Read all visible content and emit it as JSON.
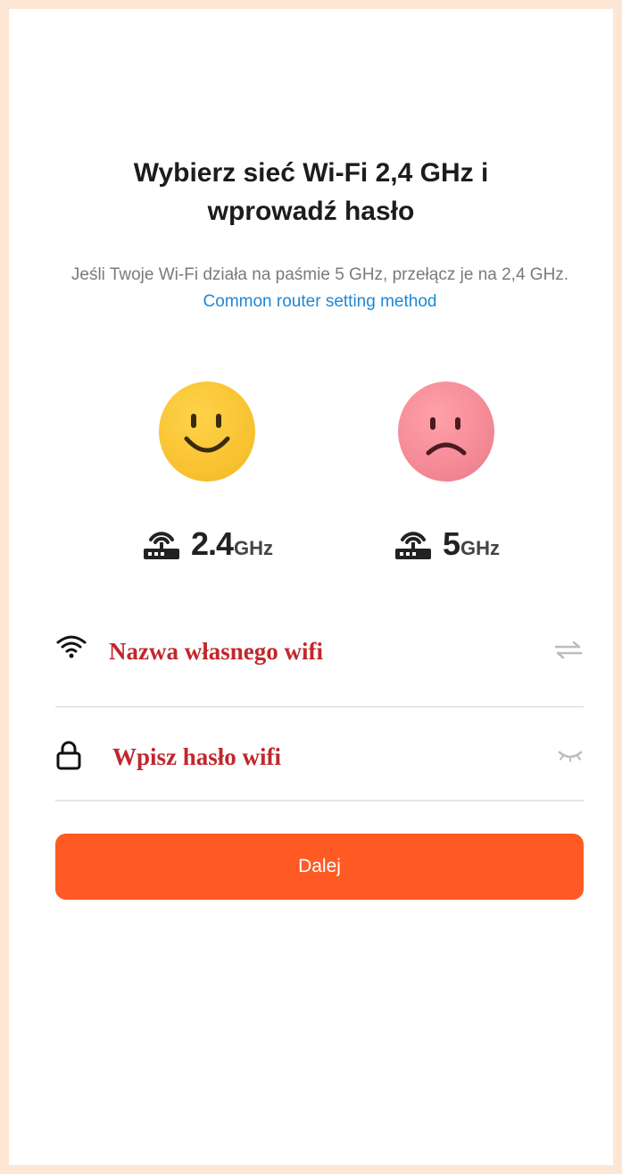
{
  "header": {
    "title_line1": "Wybierz sieć Wi-Fi 2,4 GHz i",
    "title_line2": "wprowadź hasło",
    "subtitle_text": "Jeśli Twoje Wi-Fi działa na paśmie 5 GHz, przełącz je na 2,4 GHz.",
    "subtitle_link": "Common router setting method"
  },
  "bands": {
    "good": {
      "number": "2.4",
      "unit": "GHz",
      "face_icon": "smiley-face-icon",
      "color": "#f7c02e"
    },
    "bad": {
      "number": "5",
      "unit": "GHz",
      "face_icon": "sad-face-icon",
      "color": "#f28693"
    }
  },
  "form": {
    "wifi_name_value": "Nazwa własnego wifi",
    "wifi_icon": "wifi-icon",
    "switch_icon": "switch-network-icon",
    "password_value": "Wpisz hasło wifi",
    "lock_icon": "lock-icon",
    "eye_icon": "eye-closed-icon",
    "input_text_color": "#c1272d"
  },
  "actions": {
    "next_label": "Dalej",
    "next_color": "#ff5a23"
  },
  "colors": {
    "background": "#fde6d3",
    "link": "#1f87d6"
  }
}
